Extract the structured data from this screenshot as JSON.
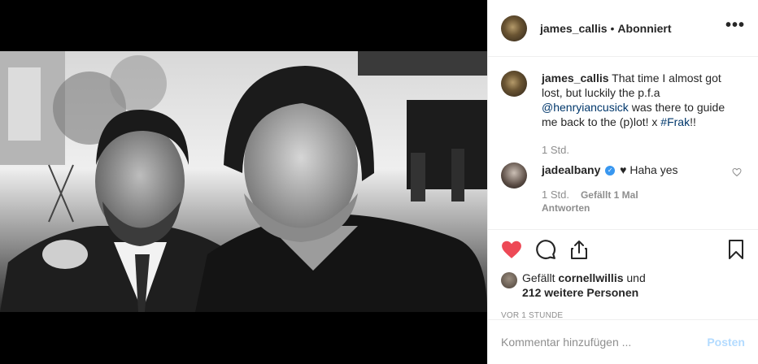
{
  "header": {
    "username": "james_callis",
    "separator": "•",
    "follow_status": "Abonniert",
    "more_label": "•••"
  },
  "caption": {
    "username": "james_callis",
    "text_1": "That time I almost got lost, but luckily the p.f.a ",
    "mention": "@henryiancusick",
    "text_2": " was there to guide me back to the (p)lot! x ",
    "hashtag": "#Frak",
    "text_3": "!!",
    "time": "1 Std."
  },
  "reply": {
    "username": "jadealbany",
    "verified_mark": "✓",
    "heart_emoji": "♥",
    "text": " Haha yes",
    "time": "1 Std.",
    "likes": "Gefällt 1 Mal",
    "reply_label": "Antworten"
  },
  "likes": {
    "prefix": "Gefällt ",
    "user": "cornellwillis",
    "middle": " und",
    "others": "212 weitere Personen"
  },
  "timestamp": "VOR 1 STUNDE",
  "comment_box": {
    "placeholder": "Kommentar hinzufügen ...",
    "post_label": "Posten"
  },
  "colors": {
    "like_heart": "#ed4956",
    "link": "#00376b",
    "post_button": "#b3dbff",
    "verified": "#3897f0"
  },
  "icons": [
    "heart-icon",
    "comment-icon",
    "share-icon",
    "bookmark-icon",
    "more-icon",
    "small-heart-icon",
    "verified-icon"
  ]
}
